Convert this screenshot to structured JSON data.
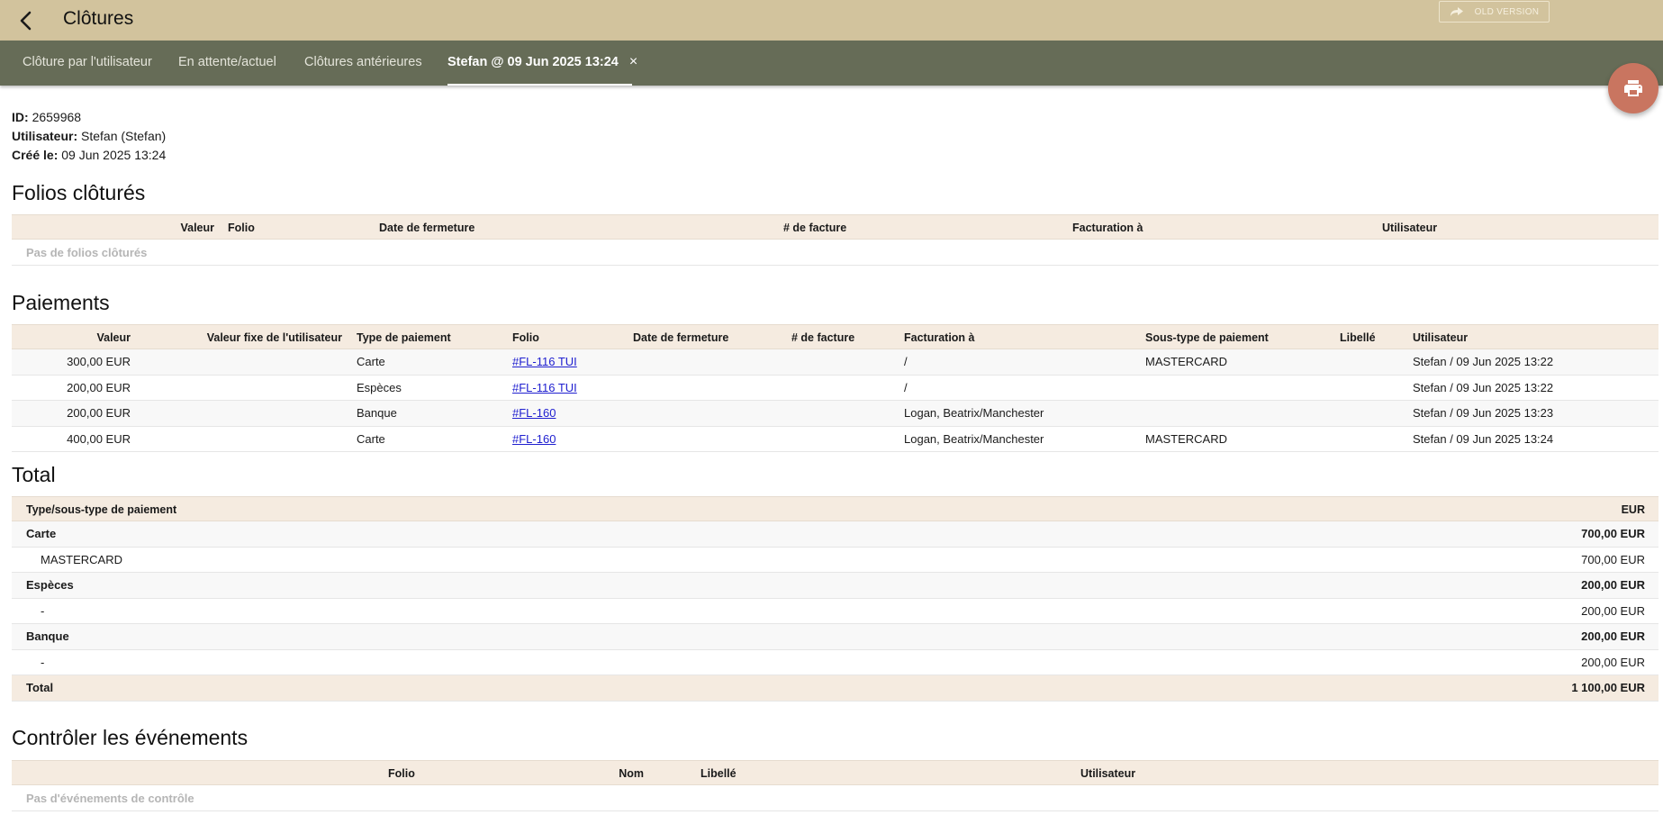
{
  "header": {
    "title": "Clôtures",
    "old_version_label": "OLD VERSION"
  },
  "tabs": [
    {
      "label": "Clôture par l'utilisateur"
    },
    {
      "label": "En attente/actuel"
    },
    {
      "label": "Clôtures antérieures"
    },
    {
      "label": "Stefan @ 09 Jun 2025 13:24",
      "close": "×"
    }
  ],
  "meta": {
    "id_label": "ID:",
    "id_value": "2659968",
    "user_label": "Utilisateur:",
    "user_value": "Stefan (Stefan)",
    "created_label": "Créé le:",
    "created_value": "09 Jun 2025 13:24"
  },
  "folios": {
    "title": "Folios clôturés",
    "columns": [
      "Valeur",
      "Folio",
      "Date de fermeture",
      "# de facture",
      "Facturation à",
      "Utilisateur"
    ],
    "empty": "Pas de folios clôturés"
  },
  "payments": {
    "title": "Paiements",
    "columns": [
      "Valeur",
      "Valeur fixe de l'utilisateur",
      "Type de paiement",
      "Folio",
      "Date de fermeture",
      "# de facture",
      "Facturation à",
      "Sous-type de paiement",
      "Libellé",
      "Utilisateur"
    ],
    "rows": [
      {
        "value": "300,00 EUR",
        "fixed": "",
        "type": "Carte",
        "folio": "#FL-116 TUI",
        "close_date": "",
        "invoice": "",
        "billing": "/",
        "subtype": "MASTERCARD",
        "label": "",
        "user": "Stefan / 09 Jun 2025 13:22"
      },
      {
        "value": "200,00 EUR",
        "fixed": "",
        "type": "Espèces",
        "folio": "#FL-116 TUI",
        "close_date": "",
        "invoice": "",
        "billing": "/",
        "subtype": "",
        "label": "",
        "user": "Stefan / 09 Jun 2025 13:22"
      },
      {
        "value": "200,00 EUR",
        "fixed": "",
        "type": "Banque",
        "folio": "#FL-160",
        "close_date": "",
        "invoice": "",
        "billing": "Logan, Beatrix/Manchester",
        "subtype": "",
        "label": "",
        "user": "Stefan / 09 Jun 2025 13:23"
      },
      {
        "value": "400,00 EUR",
        "fixed": "",
        "type": "Carte",
        "folio": "#FL-160",
        "close_date": "",
        "invoice": "",
        "billing": "Logan, Beatrix/Manchester",
        "subtype": "MASTERCARD",
        "label": "",
        "user": "Stefan / 09 Jun 2025 13:24"
      }
    ]
  },
  "total": {
    "title": "Total",
    "head_label": "Type/sous-type de paiement",
    "head_currency": "EUR",
    "rows": [
      {
        "label": "Carte",
        "amount": "700,00 EUR"
      },
      {
        "label": "MASTERCARD",
        "amount": "700,00 EUR"
      },
      {
        "label": "Espèces",
        "amount": "200,00 EUR"
      },
      {
        "label": "-",
        "amount": "200,00 EUR"
      },
      {
        "label": "Banque",
        "amount": "200,00 EUR"
      },
      {
        "label": "-",
        "amount": "200,00 EUR"
      },
      {
        "label": "Total",
        "amount": "1 100,00 EUR"
      }
    ]
  },
  "events": {
    "title": "Contrôler les événements",
    "columns": [
      "Nom",
      "Folio",
      "Libellé",
      "Utilisateur"
    ],
    "empty": "Pas d'événements de contrôle"
  },
  "colors": {
    "header_bg": "#d2c39d",
    "tabbar_bg": "#666c57",
    "fab_bg": "#c97560",
    "table_header_bg": "#f5ebe0",
    "link": "#2020d0"
  }
}
